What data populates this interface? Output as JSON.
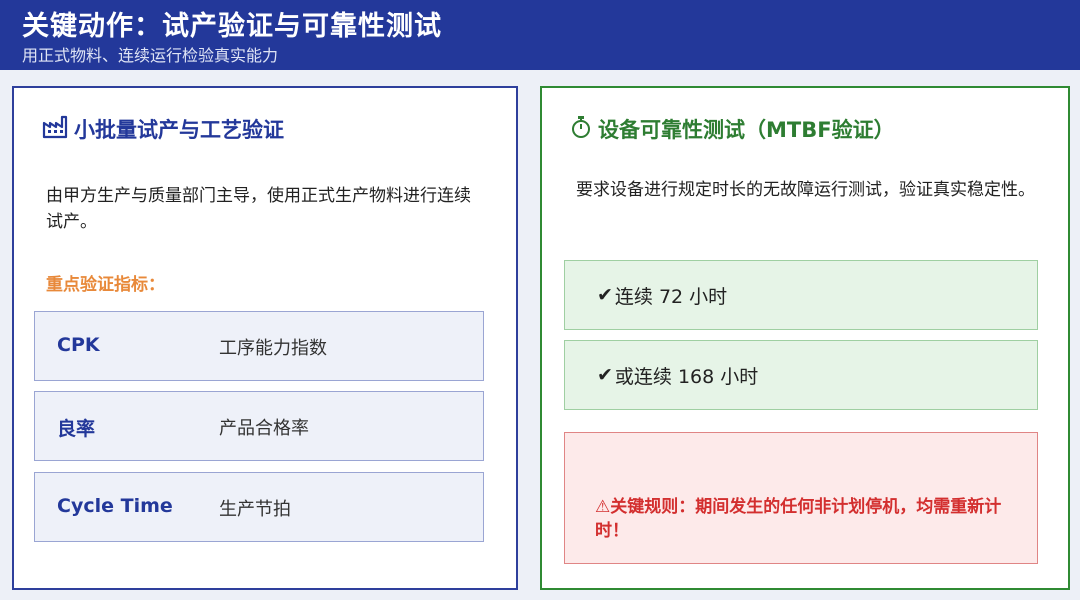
{
  "header": {
    "title": "关键动作：试产验证与可靠性测试",
    "subtitle": "用正式物料、连续运行检验真实能力"
  },
  "left_panel": {
    "title": "小批量试产与工艺验证",
    "icon": "factory-icon",
    "description": "由甲方生产与质量部门主导，使用正式生产物料进行连续试产。",
    "metrics_label": "重点验证指标：",
    "metrics": [
      {
        "key": "CPK",
        "value": "工序能力指数"
      },
      {
        "key": "良率",
        "value": "产品合格率"
      },
      {
        "key": "Cycle Time",
        "value": "生产节拍"
      }
    ]
  },
  "right_panel": {
    "title": "设备可靠性测试（MTBF验证）",
    "icon": "stopwatch-icon",
    "description": "要求设备进行规定时长的无故障运行测试，验证真实稳定性。",
    "checks": [
      {
        "mark": "✔",
        "text": "连续 72 小时"
      },
      {
        "mark": "✔",
        "text": "或连续 168 小时"
      }
    ],
    "rule": {
      "icon": "⚠",
      "text": "关键规则：期间发生的任何非计划停机，均需重新计时！"
    }
  },
  "colors": {
    "header_bg": "#23389a",
    "left_accent": "#23389a",
    "right_accent": "#2e7d32",
    "orange": "#e8893a",
    "alert_red": "#d32f2f"
  }
}
